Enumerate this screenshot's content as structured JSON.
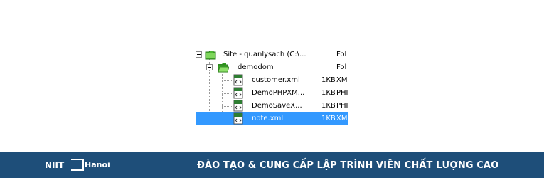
{
  "tree": {
    "root": {
      "name": "Site - quanlysach (C:\\...",
      "type": "Fol",
      "icon": "folder-icon"
    },
    "folder": {
      "name": "demodom",
      "type": "Fol",
      "icon": "folder-open-icon"
    },
    "files": [
      {
        "name": "customer.xml",
        "size": "1KB",
        "type": "XM",
        "icon": "xml-file-icon",
        "selected": false
      },
      {
        "name": "DemoPHPXM...",
        "size": "1KB",
        "type": "PHI",
        "icon": "php-file-icon",
        "selected": false
      },
      {
        "name": "DemoSaveX...",
        "size": "1KB",
        "type": "PHI",
        "icon": "php-file-icon",
        "selected": false
      },
      {
        "name": "note.xml",
        "size": "1KB",
        "type": "XM",
        "icon": "xml-file-icon",
        "selected": true
      }
    ],
    "colors": {
      "selection": "#3399ff",
      "folder": "#3fae2a"
    }
  },
  "banner": {
    "logo": {
      "brand": "NIIT",
      "city": "Hanoi"
    },
    "tagline": "ĐÀO TẠO & CUNG CẤP LẬP TRÌNH VIÊN CHẤT LƯỢNG CAO",
    "background": "#1e4e79"
  }
}
